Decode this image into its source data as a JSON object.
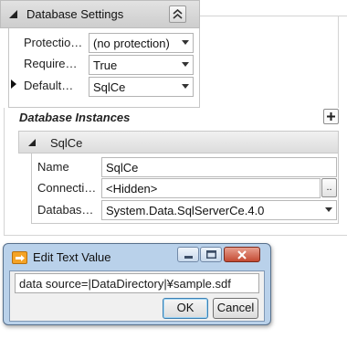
{
  "settings": {
    "title": "Database Settings",
    "properties": [
      {
        "label": "Protectio…",
        "value": "(no protection)"
      },
      {
        "label": "Require…",
        "value": "True"
      },
      {
        "label": "Default…",
        "value": "SqlCe"
      }
    ]
  },
  "instances": {
    "title": "Database Instances",
    "instance_name": "SqlCe",
    "fields": [
      {
        "label": "Name",
        "value": "SqlCe"
      },
      {
        "label": "Connecti…",
        "value": "<Hidden>"
      },
      {
        "label": "Databas…",
        "value": "System.Data.SqlServerCe.4.0"
      }
    ],
    "browse_label": ".."
  },
  "dialog": {
    "title": "Edit Text Value",
    "input_value": "data source=|DataDirectory|¥sample.sdf",
    "ok_label": "OK",
    "cancel_label": "Cancel"
  },
  "icons": {
    "section_collapse": "triangle-collapse-icon",
    "collapse": "double-chevron-up-icon",
    "add": "plus-icon",
    "dropdown": "dropdown-arrow-icon",
    "row_pointer": "row-pointer-icon"
  }
}
